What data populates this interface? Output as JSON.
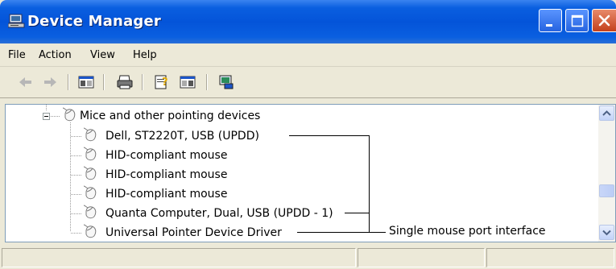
{
  "window": {
    "title": "Device Manager"
  },
  "menu": {
    "items": [
      "File",
      "Action",
      "View",
      "Help"
    ]
  },
  "toolbar": {
    "icons": [
      "back-arrow-icon",
      "forward-arrow-icon",
      "show-hide-console-tree-icon",
      "print-icon",
      "properties-help-icon",
      "properties-icon",
      "scan-hardware-icon"
    ]
  },
  "tree": {
    "category": "Mice and other pointing devices",
    "devices": [
      "Dell, ST2220T, USB (UPDD)",
      "HID-compliant mouse",
      "HID-compliant mouse",
      "HID-compliant mouse",
      "Quanta Computer, Dual, USB (UPDD - 1)",
      "Universal Pointer Device Driver"
    ]
  },
  "annotation": {
    "label": "Single mouse port interface"
  },
  "colors": {
    "titlebar": "#0454d9",
    "close_button": "#c4401c",
    "chrome": "#ece9d8"
  }
}
